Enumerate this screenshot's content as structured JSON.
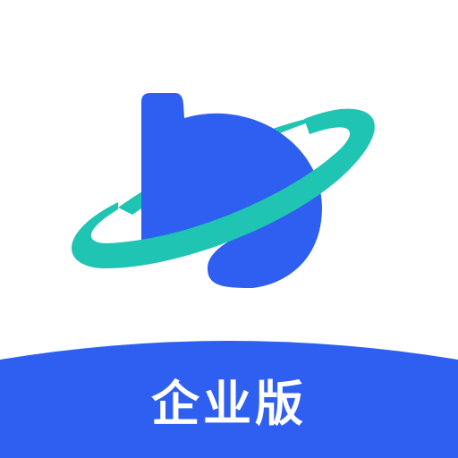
{
  "app_icon": {
    "edition_label": "企业版",
    "logo_icon": "planet-with-ring-icon",
    "colors": {
      "background": "#ffffff",
      "planet": "#2f5ff0",
      "ring": "#1fc4b2",
      "banner": "#2f5ff0",
      "label_text": "#ffffff"
    }
  }
}
